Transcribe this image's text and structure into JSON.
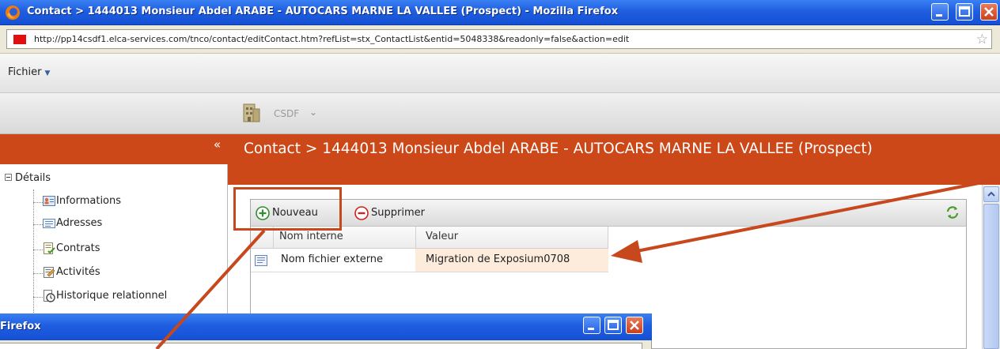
{
  "window": {
    "title": "Contact > 1444013 Monsieur Abdel ARABE - AUTOCARS MARNE LA VALLEE (Prospect) - Mozilla Firefox",
    "url": "http://pp14csdf1.elca-services.com/tnco/contact/editContact.htm?refList=stx_ContactList&entid=5048338&readonly=false&action=edit"
  },
  "menu": {
    "fichier": "Fichier"
  },
  "toolbar": {
    "app_label": "CSDF"
  },
  "sidebar": {
    "collapse": "«",
    "root": "Détails",
    "items": [
      {
        "label": "Informations",
        "icon": "contact-card-icon"
      },
      {
        "label": "Adresses",
        "icon": "address-icon"
      },
      {
        "label": "Contrats",
        "icon": "contract-icon"
      },
      {
        "label": "Activités",
        "icon": "activity-icon"
      },
      {
        "label": "Historique relationnel",
        "icon": "history-icon"
      }
    ]
  },
  "main": {
    "title": "Contact > 1444013 Monsieur Abdel ARABE - AUTOCARS MARNE LA VALLEE (Prospect)",
    "buttons": {
      "new": "Nouveau",
      "delete": "Supprimer"
    },
    "columns": [
      "Nom interne",
      "Valeur"
    ],
    "rows": [
      {
        "name": "Nom fichier externe",
        "value": "Migration de Exposium0708"
      }
    ]
  },
  "second_window": {
    "title": "Firefox"
  },
  "colors": {
    "accent": "#cc4818",
    "xp_blue": "#1f5ee0",
    "callout": "#c8481e"
  }
}
